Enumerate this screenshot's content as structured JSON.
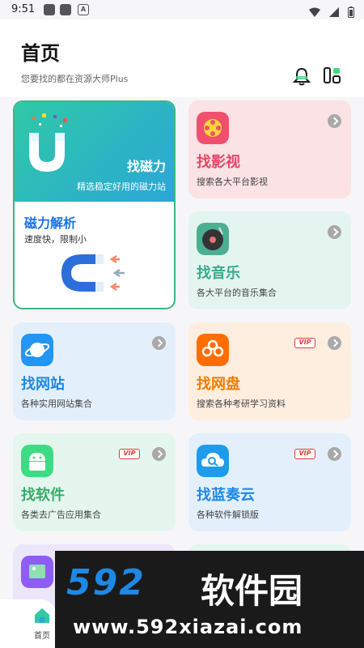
{
  "status_bar": {
    "time": "9:51",
    "badge": "A"
  },
  "header": {
    "title": "首页",
    "subtitle": "您要找的都在资源大师Plus"
  },
  "magnet_card": {
    "title": "找磁力",
    "desc": "精选稳定好用的磁力站",
    "sub_title": "磁力解析",
    "sub_desc": "速度快，限制小",
    "colors": {
      "border": "#38b981",
      "gradient_from": "#2fc9a6",
      "gradient_to": "#2ba6d8",
      "sub_title": "#1a73e8"
    }
  },
  "cards": [
    {
      "id": "video",
      "title": "找影视",
      "desc": "搜索各大平台影视",
      "vip": "",
      "icon": "film-reel-icon",
      "bg": "#fbe2e4",
      "title_color": "#e8456a",
      "icon_color": "#f0506e"
    },
    {
      "id": "music",
      "title": "找音乐",
      "desc": "各大平台的音乐集合",
      "vip": "",
      "icon": "vinyl-icon",
      "bg": "#e4f5f0",
      "title_color": "#3aab8a",
      "icon_color": "#4caf93"
    },
    {
      "id": "site",
      "title": "找网站",
      "desc": "各种实用网站集合",
      "vip": "",
      "icon": "planet-icon",
      "bg": "#e3f0fc",
      "title_color": "#1e88e5",
      "icon_color": "#2196f3"
    },
    {
      "id": "pan",
      "title": "找网盘",
      "desc": "搜索各种考研学习资料",
      "vip": "VIP",
      "icon": "cloud-link-icon",
      "bg": "#fdeee0",
      "title_color": "#f57c00",
      "icon_color": "#ff6d00"
    },
    {
      "id": "soft",
      "title": "找软件",
      "desc": "各类去广告应用集合",
      "vip": "VIP",
      "icon": "android-icon",
      "bg": "#e4f6ee",
      "title_color": "#3aab6a",
      "icon_color": "#3ddc84"
    },
    {
      "id": "lanzou",
      "title": "找蓝奏云",
      "desc": "各种软件解锁版",
      "vip": "VIP",
      "icon": "cloud-search-icon",
      "bg": "#e3f0fc",
      "title_color": "#1e88e5",
      "icon_color": "#1e9be9"
    }
  ],
  "bottom_nav": {
    "home_label": "首页"
  },
  "watermark": {
    "number": "592",
    "name": "软件园",
    "url": "www.592xiazai.com"
  }
}
